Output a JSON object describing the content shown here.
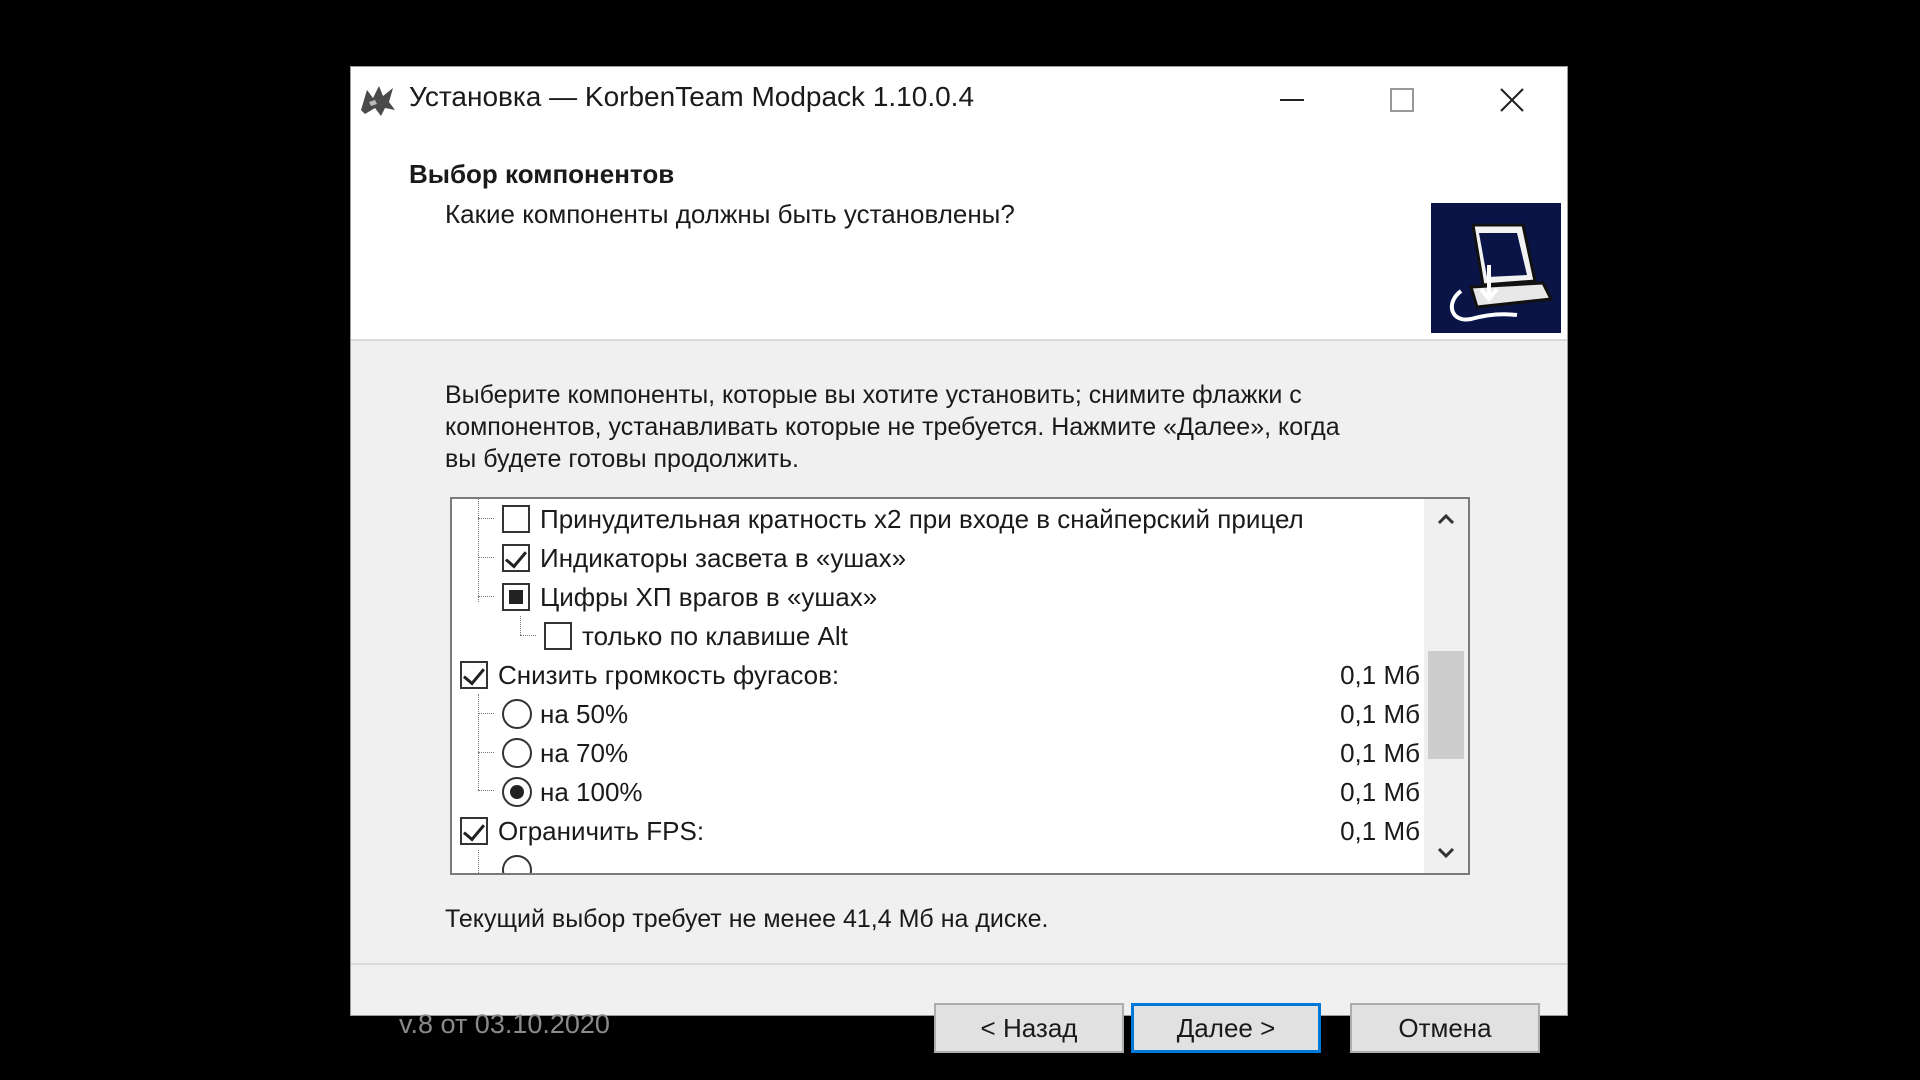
{
  "window": {
    "title": "Установка — KorbenTeam Modpack 1.10.0.4",
    "app_icon": "wolf-logo-icon",
    "controls": [
      "minimize-icon",
      "maximize-icon",
      "close-icon"
    ]
  },
  "header": {
    "title": "Выбор компонентов",
    "subtitle": "Какие компоненты должны быть установлены?",
    "image": "computer-install-icon"
  },
  "instructions": {
    "line1": "Выберите компоненты, которые вы хотите установить; снимите флажки с",
    "line2": "компонентов, устанавливать которые не требуется. Нажмите «Далее», когда",
    "line3": "вы будете готовы продолжить."
  },
  "components": [
    {
      "label": "Принудительная кратность x2 при входе в снайперский прицел",
      "control": "checkbox",
      "state": "unchecked",
      "level": 1,
      "size": ""
    },
    {
      "label": "Индикаторы засвета в «ушах»",
      "control": "checkbox",
      "state": "checked",
      "level": 1,
      "size": ""
    },
    {
      "label": "Цифры ХП врагов в «ушах»",
      "control": "checkbox",
      "state": "partial",
      "level": 1,
      "size": ""
    },
    {
      "label": "только по клавише Alt",
      "control": "checkbox",
      "state": "unchecked",
      "level": 2,
      "size": ""
    },
    {
      "label": "Снизить громкость фугасов:",
      "control": "checkbox",
      "state": "checked",
      "level": 0,
      "size": "0,1 Мб"
    },
    {
      "label": "на 50%",
      "control": "radio",
      "state": "unselected",
      "level": 1,
      "size": "0,1 Мб"
    },
    {
      "label": "на 70%",
      "control": "radio",
      "state": "unselected",
      "level": 1,
      "size": "0,1 Мб"
    },
    {
      "label": "на 100%",
      "control": "radio",
      "state": "selected",
      "level": 1,
      "size": "0,1 Мб"
    },
    {
      "label": "Ограничить FPS:",
      "control": "checkbox",
      "state": "checked",
      "level": 0,
      "size": "0,1 Мб"
    }
  ],
  "disk_requirement": "Текущий выбор требует не менее 41,4 Мб на диске.",
  "version": "v.8 от 03.10.2020",
  "buttons": {
    "back": "< Назад",
    "next": "Далее >",
    "cancel": "Отмена"
  },
  "colors": {
    "focus_border": "#0078d7",
    "header_image_bg": "#0a1446"
  }
}
